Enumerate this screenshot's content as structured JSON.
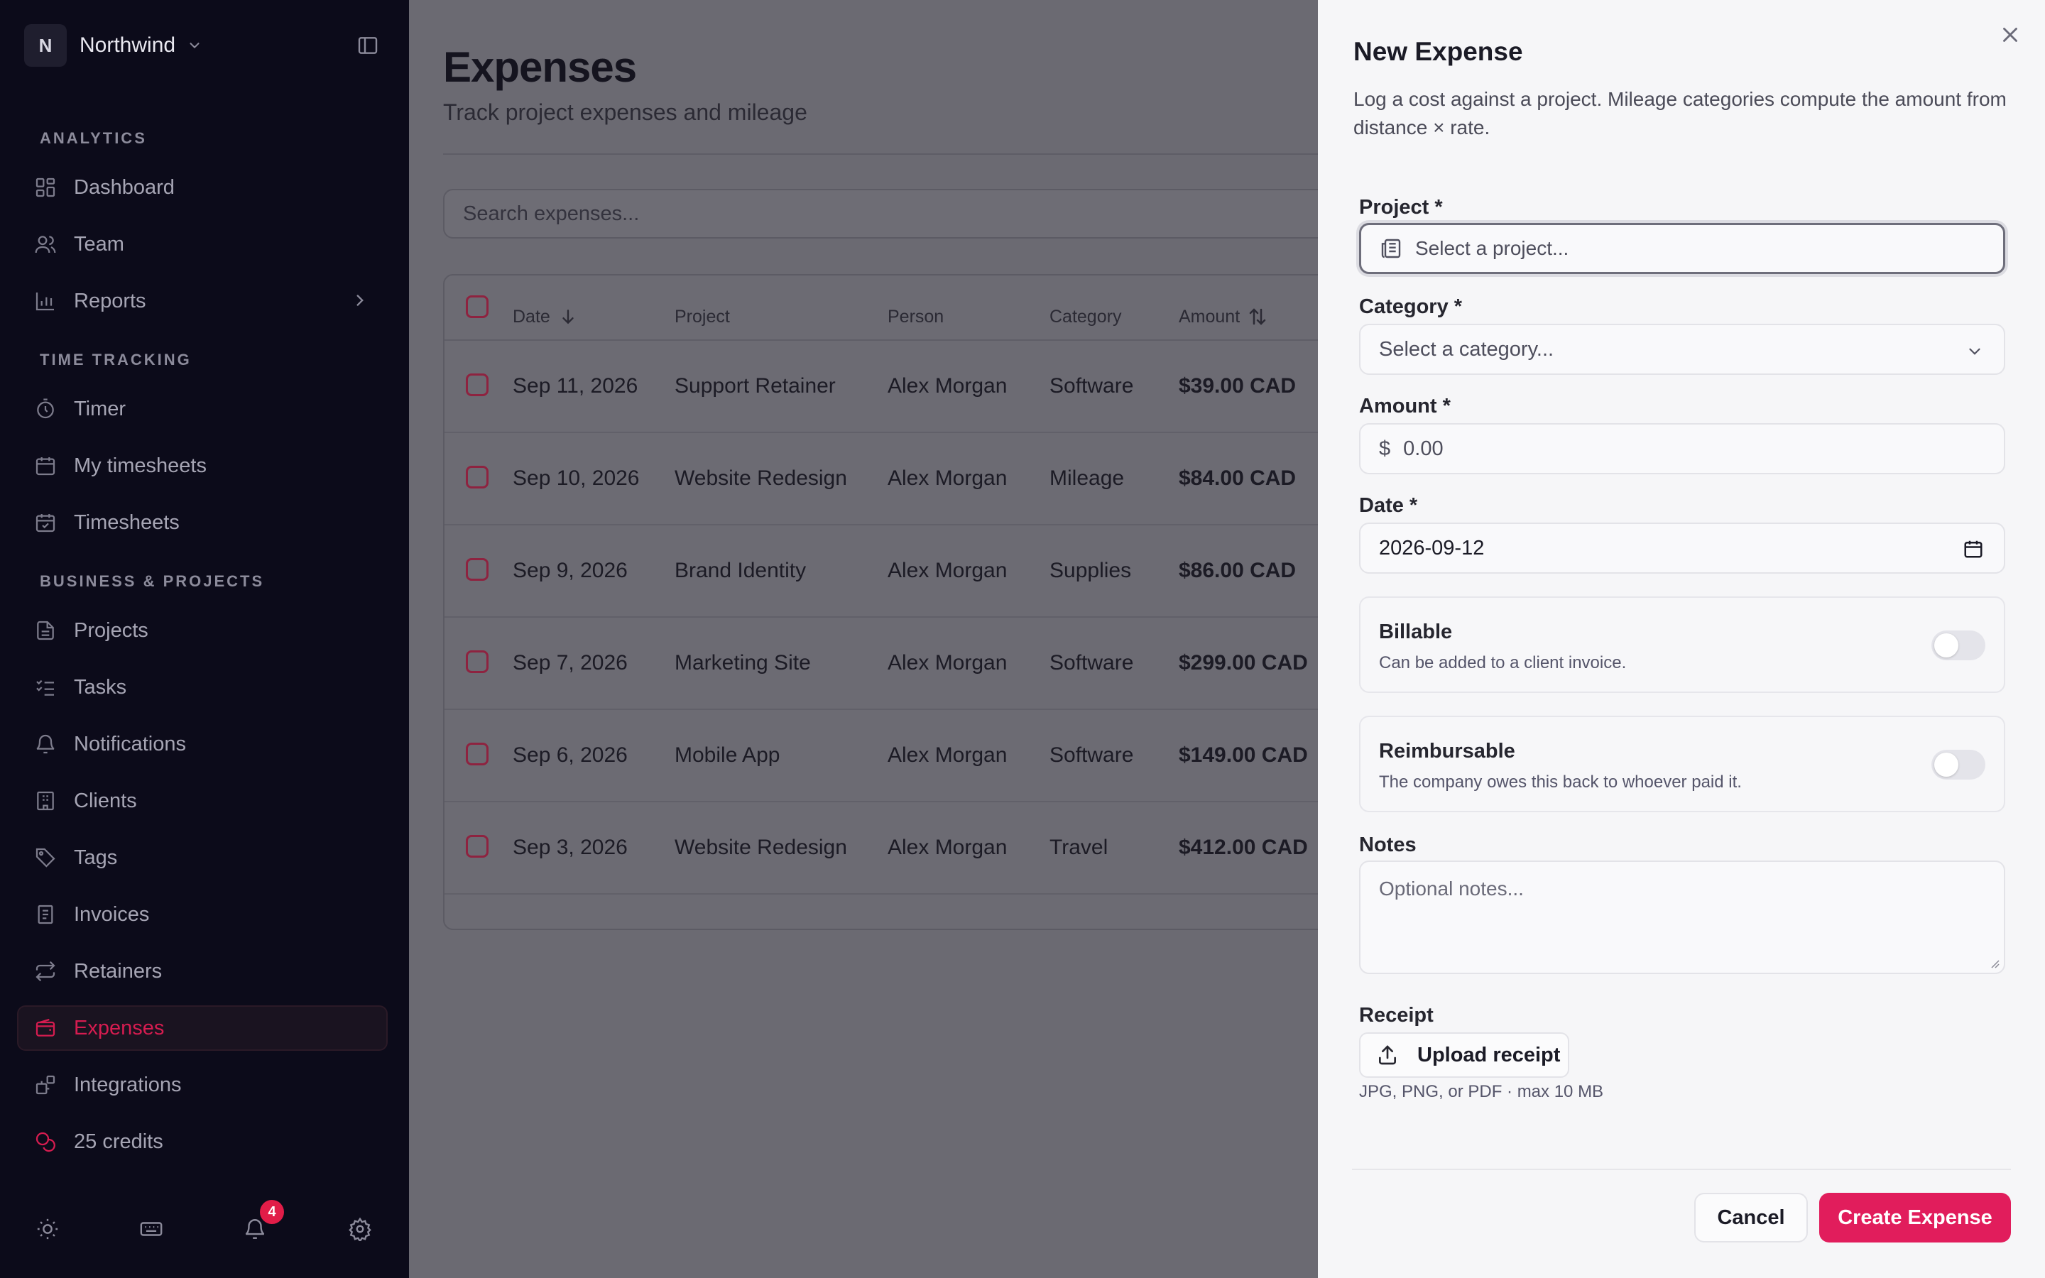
{
  "sidebar": {
    "workspace_initial": "N",
    "workspace_name": "Northwind",
    "sections": {
      "analytics": "ANALYTICS",
      "time_tracking": "TIME TRACKING",
      "business": "BUSINESS & PROJECTS"
    },
    "items": {
      "dashboard": "Dashboard",
      "team": "Team",
      "reports": "Reports",
      "timer": "Timer",
      "my_timesheets": "My timesheets",
      "timesheets": "Timesheets",
      "projects": "Projects",
      "tasks": "Tasks",
      "notifications": "Notifications",
      "clients": "Clients",
      "tags": "Tags",
      "invoices": "Invoices",
      "retainers": "Retainers",
      "expenses": "Expenses",
      "integrations": "Integrations",
      "credits": "25 credits"
    },
    "notification_count": "4",
    "accent_color": "#d61c50"
  },
  "main": {
    "title": "Expenses",
    "subtitle": "Track project expenses and mileage",
    "search_placeholder": "Search expenses...",
    "columns": {
      "date": "Date",
      "project": "Project",
      "person": "Person",
      "category": "Category",
      "amount": "Amount"
    },
    "rows": [
      {
        "date": "Sep 11, 2026",
        "project": "Support Retainer",
        "person": "Alex Morgan",
        "category": "Software",
        "amount": "$39.00 CAD"
      },
      {
        "date": "Sep 10, 2026",
        "project": "Website Redesign",
        "person": "Alex Morgan",
        "category": "Mileage",
        "amount": "$84.00 CAD"
      },
      {
        "date": "Sep 9, 2026",
        "project": "Brand Identity",
        "person": "Alex Morgan",
        "category": "Supplies",
        "amount": "$86.00 CAD"
      },
      {
        "date": "Sep 7, 2026",
        "project": "Marketing Site",
        "person": "Alex Morgan",
        "category": "Software",
        "amount": "$299.00 CAD"
      },
      {
        "date": "Sep 6, 2026",
        "project": "Mobile App",
        "person": "Alex Morgan",
        "category": "Software",
        "amount": "$149.00 CAD"
      },
      {
        "date": "Sep 3, 2026",
        "project": "Website Redesign",
        "person": "Alex Morgan",
        "category": "Travel",
        "amount": "$412.00 CAD"
      }
    ]
  },
  "drawer": {
    "title": "New Expense",
    "description": "Log a cost against a project. Mileage categories compute the amount from distance × rate.",
    "project_label": "Project *",
    "project_placeholder": "Select a project...",
    "category_label": "Category *",
    "category_placeholder": "Select a category...",
    "amount_label": "Amount *",
    "amount_currency": "$",
    "amount_placeholder": "0.00",
    "date_label": "Date *",
    "date_value": "2026-09-12",
    "billable_title": "Billable",
    "billable_desc": "Can be added to a client invoice.",
    "billable_on": false,
    "reimbursable_title": "Reimbursable",
    "reimbursable_desc": "The company owes this back to whoever paid it.",
    "reimbursable_on": false,
    "notes_label": "Notes",
    "notes_placeholder": "Optional notes...",
    "receipt_label": "Receipt",
    "upload_label": "Upload receipt",
    "upload_hint": "JPG, PNG, or PDF · max 10 MB",
    "cancel_label": "Cancel",
    "create_label": "Create Expense",
    "primary_color": "#e11d5c"
  }
}
